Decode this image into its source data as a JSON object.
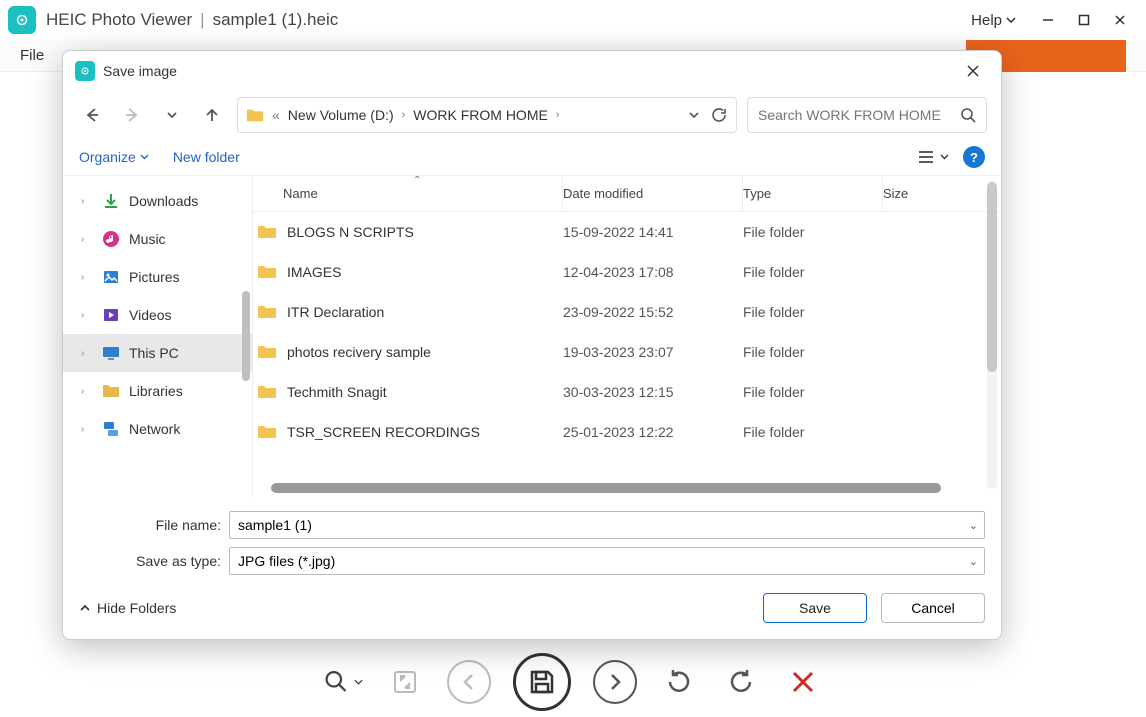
{
  "app": {
    "title": "HEIC Photo Viewer",
    "open_file": "sample1 (1).heic",
    "help_label": "Help"
  },
  "menubar": {
    "file": "File"
  },
  "dialog": {
    "title": "Save image",
    "nav": {
      "drive_label": "New Volume (D:)",
      "folder_label": "WORK FROM HOME"
    },
    "search_placeholder": "Search WORK FROM HOME",
    "toolbar": {
      "organize": "Organize",
      "new_folder": "New folder"
    },
    "tree": [
      {
        "label": "Downloads",
        "icon": "download",
        "color": "#2e9e4f"
      },
      {
        "label": "Music",
        "icon": "music",
        "color": "#d63384"
      },
      {
        "label": "Pictures",
        "icon": "pictures",
        "color": "#2f7fd1"
      },
      {
        "label": "Videos",
        "icon": "videos",
        "color": "#6b3fb8"
      },
      {
        "label": "This PC",
        "icon": "pc",
        "color": "#2f7fd1",
        "selected": true
      },
      {
        "label": "Libraries",
        "icon": "folder",
        "color": "#e8b84a"
      },
      {
        "label": "Network",
        "icon": "network",
        "color": "#2f7fd1"
      }
    ],
    "columns": {
      "name": "Name",
      "date": "Date modified",
      "type": "Type",
      "size": "Size"
    },
    "rows": [
      {
        "name": "BLOGS N SCRIPTS",
        "date": "15-09-2022 14:41",
        "type": "File folder"
      },
      {
        "name": "IMAGES",
        "date": "12-04-2023 17:08",
        "type": "File folder"
      },
      {
        "name": "ITR Declaration",
        "date": "23-09-2022 15:52",
        "type": "File folder"
      },
      {
        "name": "photos recivery sample",
        "date": "19-03-2023 23:07",
        "type": "File folder"
      },
      {
        "name": "Techmith Snagit",
        "date": "30-03-2023 12:15",
        "type": "File folder"
      },
      {
        "name": "TSR_SCREEN RECORDINGS",
        "date": "25-01-2023 12:22",
        "type": "File folder"
      }
    ],
    "fields": {
      "file_name_label": "File name:",
      "file_name_value": "sample1 (1)",
      "save_type_label": "Save as type:",
      "save_type_value": "JPG files (*.jpg)"
    },
    "footer": {
      "hide_folders": "Hide Folders",
      "save": "Save",
      "cancel": "Cancel"
    }
  }
}
